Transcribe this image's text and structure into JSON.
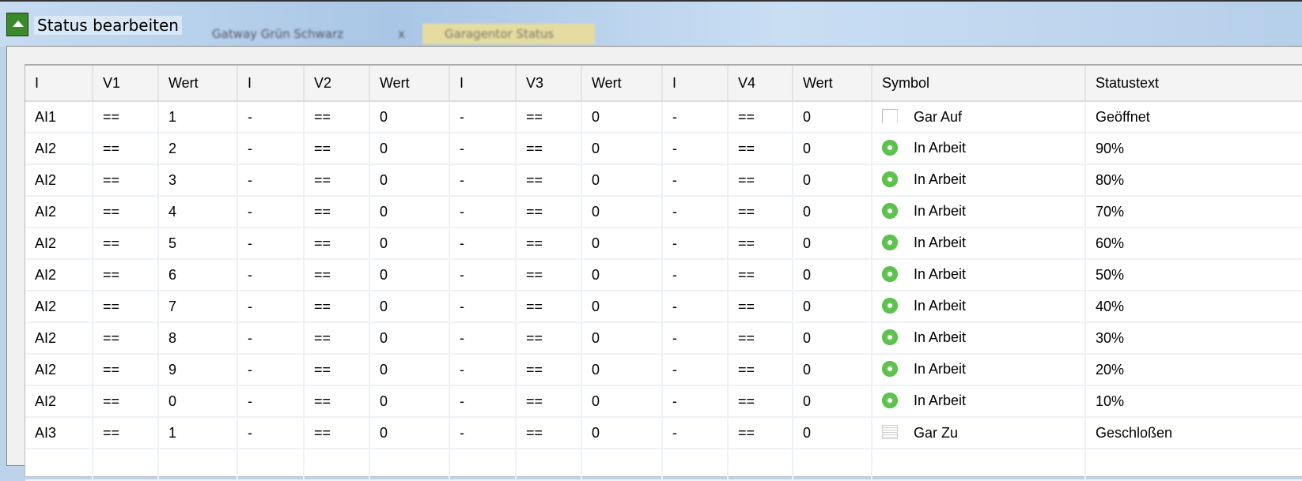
{
  "window": {
    "title": "Status bearbeiten",
    "tabs": [
      "Gatway Grün Schwarz",
      "Garagentor Status"
    ],
    "tab_close": "x"
  },
  "columns": [
    "I",
    "V1",
    "Wert",
    "I",
    "V2",
    "Wert",
    "I",
    "V3",
    "Wert",
    "I",
    "V4",
    "Wert",
    "Symbol",
    "Statustext"
  ],
  "rows": [
    {
      "c": [
        "AI1",
        "==",
        "1",
        "-",
        "==",
        "0",
        "-",
        "==",
        "0",
        "-",
        "==",
        "0"
      ],
      "icon": "blank-icon",
      "symbol": "Gar Auf",
      "status": "Geöffnet"
    },
    {
      "c": [
        "AI2",
        "==",
        "2",
        "-",
        "==",
        "0",
        "-",
        "==",
        "0",
        "-",
        "==",
        "0"
      ],
      "icon": "gear-icon",
      "symbol": "In Arbeit",
      "status": "90%"
    },
    {
      "c": [
        "AI2",
        "==",
        "3",
        "-",
        "==",
        "0",
        "-",
        "==",
        "0",
        "-",
        "==",
        "0"
      ],
      "icon": "gear-icon",
      "symbol": "In Arbeit",
      "status": "80%"
    },
    {
      "c": [
        "AI2",
        "==",
        "4",
        "-",
        "==",
        "0",
        "-",
        "==",
        "0",
        "-",
        "==",
        "0"
      ],
      "icon": "gear-icon",
      "symbol": "In Arbeit",
      "status": "70%"
    },
    {
      "c": [
        "AI2",
        "==",
        "5",
        "-",
        "==",
        "0",
        "-",
        "==",
        "0",
        "-",
        "==",
        "0"
      ],
      "icon": "gear-icon",
      "symbol": "In Arbeit",
      "status": "60%"
    },
    {
      "c": [
        "AI2",
        "==",
        "6",
        "-",
        "==",
        "0",
        "-",
        "==",
        "0",
        "-",
        "==",
        "0"
      ],
      "icon": "gear-icon",
      "symbol": "In Arbeit",
      "status": "50%"
    },
    {
      "c": [
        "AI2",
        "==",
        "7",
        "-",
        "==",
        "0",
        "-",
        "==",
        "0",
        "-",
        "==",
        "0"
      ],
      "icon": "gear-icon",
      "symbol": "In Arbeit",
      "status": "40%"
    },
    {
      "c": [
        "AI2",
        "==",
        "8",
        "-",
        "==",
        "0",
        "-",
        "==",
        "0",
        "-",
        "==",
        "0"
      ],
      "icon": "gear-icon",
      "symbol": "In Arbeit",
      "status": "30%"
    },
    {
      "c": [
        "AI2",
        "==",
        "9",
        "-",
        "==",
        "0",
        "-",
        "==",
        "0",
        "-",
        "==",
        "0"
      ],
      "icon": "gear-icon",
      "symbol": "In Arbeit",
      "status": "20%"
    },
    {
      "c": [
        "AI2",
        "==",
        "0",
        "-",
        "==",
        "0",
        "-",
        "==",
        "0",
        "-",
        "==",
        "0"
      ],
      "icon": "gear-icon",
      "symbol": "In Arbeit",
      "status": "10%"
    },
    {
      "c": [
        "AI3",
        "==",
        "1",
        "-",
        "==",
        "0",
        "-",
        "==",
        "0",
        "-",
        "==",
        "0"
      ],
      "icon": "lines-icon",
      "symbol": "Gar Zu",
      "status": "Geschloßen"
    }
  ]
}
